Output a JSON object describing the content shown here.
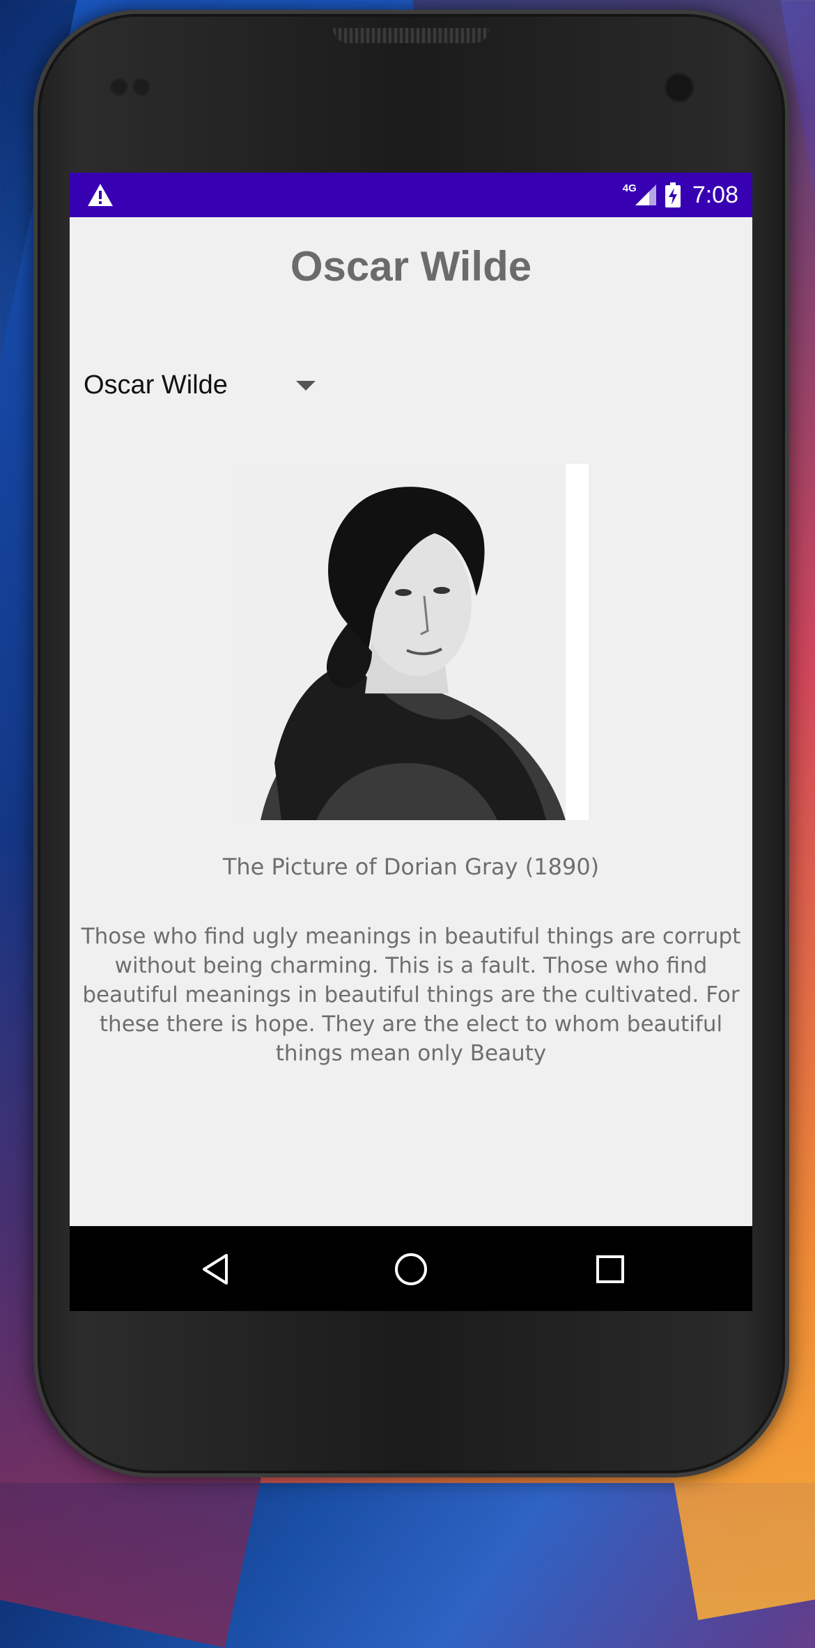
{
  "status_bar": {
    "network": "4G",
    "time": "7:08",
    "background_color": "#3700b3",
    "icons": [
      "warning-icon",
      "signal-icon",
      "battery-charging-icon"
    ]
  },
  "app": {
    "title": "Oscar Wilde",
    "spinner": {
      "selected": "Oscar Wilde"
    },
    "portrait_subject": "Oscar Wilde",
    "book": "The Picture of Dorian Gray (1890)",
    "quote": "Those who find ugly meanings in beautiful things are corrupt without being charming. This is a fault. Those who find beautiful meanings in beautiful things are the cultivated. For these there is hope. They are the elect to whom beautiful things mean only Beauty"
  },
  "nav_bar": {
    "buttons": [
      "back-icon",
      "home-icon",
      "recents-icon"
    ]
  }
}
